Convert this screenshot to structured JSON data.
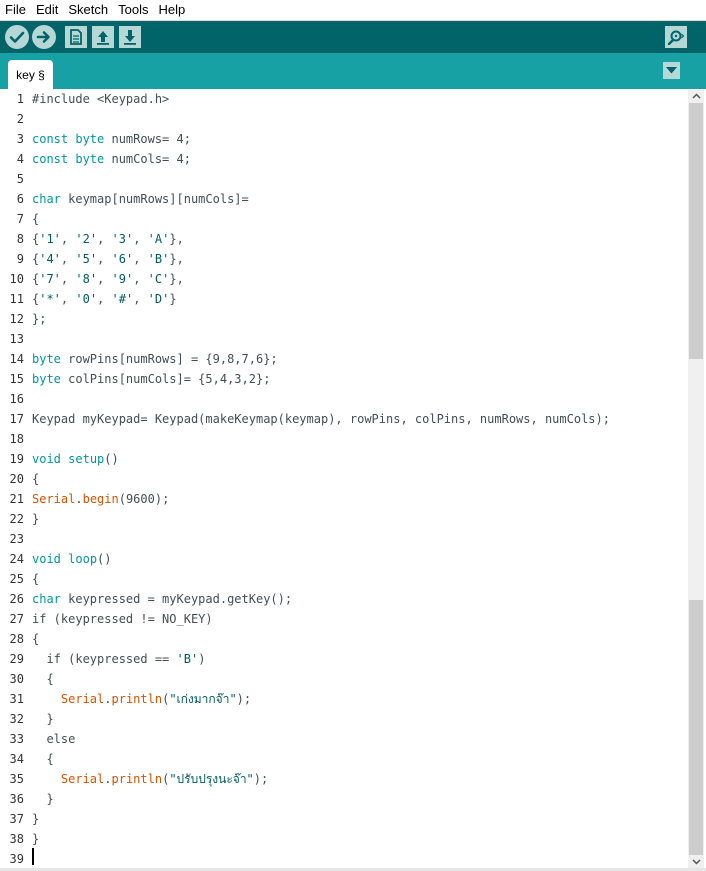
{
  "menubar": {
    "items": [
      "File",
      "Edit",
      "Sketch",
      "Tools",
      "Help"
    ]
  },
  "toolbar": {
    "buttons": [
      "check-icon",
      "arrow-right-icon",
      "new-file-icon",
      "upload-arrow-icon",
      "download-arrow-icon"
    ],
    "serial_monitor_icon": "magnifier-icon"
  },
  "tabs": [
    {
      "label": "key §",
      "active": true
    }
  ],
  "colors": {
    "toolbar_bg": "#006468",
    "tabbar_bg": "#17a1a5",
    "button_bg": "#b5d7d6",
    "keyword": "#00979c",
    "function": "#d35400",
    "string": "#005c5f",
    "text": "#434f54"
  },
  "editor": {
    "line_numbers": [
      "1",
      "2",
      "3",
      "4",
      "5",
      "6",
      "7",
      "8",
      "9",
      "10",
      "11",
      "12",
      "13",
      "14",
      "15",
      "16",
      "17",
      "18",
      "19",
      "20",
      "21",
      "22",
      "23",
      "24",
      "25",
      "26",
      "27",
      "28",
      "29",
      "30",
      "31",
      "32",
      "33",
      "34",
      "35",
      "36",
      "37",
      "38",
      "39"
    ],
    "lines": [
      [
        {
          "t": "#include <Keypad.h>",
          "c": "plain"
        }
      ],
      [],
      [
        {
          "t": "const byte",
          "c": "kw"
        },
        {
          "t": " numRows= 4;",
          "c": "plain"
        }
      ],
      [
        {
          "t": "const byte",
          "c": "kw"
        },
        {
          "t": " numCols= 4;",
          "c": "plain"
        }
      ],
      [],
      [
        {
          "t": "char",
          "c": "kw"
        },
        {
          "t": " keymap[numRows][numCols]=",
          "c": "plain"
        }
      ],
      [
        {
          "t": "{",
          "c": "plain"
        }
      ],
      [
        {
          "t": "{",
          "c": "plain"
        },
        {
          "t": "'1'",
          "c": "str"
        },
        {
          "t": ", ",
          "c": "plain"
        },
        {
          "t": "'2'",
          "c": "str"
        },
        {
          "t": ", ",
          "c": "plain"
        },
        {
          "t": "'3'",
          "c": "str"
        },
        {
          "t": ", ",
          "c": "plain"
        },
        {
          "t": "'A'",
          "c": "str"
        },
        {
          "t": "},",
          "c": "plain"
        }
      ],
      [
        {
          "t": "{",
          "c": "plain"
        },
        {
          "t": "'4'",
          "c": "str"
        },
        {
          "t": ", ",
          "c": "plain"
        },
        {
          "t": "'5'",
          "c": "str"
        },
        {
          "t": ", ",
          "c": "plain"
        },
        {
          "t": "'6'",
          "c": "str"
        },
        {
          "t": ", ",
          "c": "plain"
        },
        {
          "t": "'B'",
          "c": "str"
        },
        {
          "t": "},",
          "c": "plain"
        }
      ],
      [
        {
          "t": "{",
          "c": "plain"
        },
        {
          "t": "'7'",
          "c": "str"
        },
        {
          "t": ", ",
          "c": "plain"
        },
        {
          "t": "'8'",
          "c": "str"
        },
        {
          "t": ", ",
          "c": "plain"
        },
        {
          "t": "'9'",
          "c": "str"
        },
        {
          "t": ", ",
          "c": "plain"
        },
        {
          "t": "'C'",
          "c": "str"
        },
        {
          "t": "},",
          "c": "plain"
        }
      ],
      [
        {
          "t": "{",
          "c": "plain"
        },
        {
          "t": "'*'",
          "c": "str"
        },
        {
          "t": ", ",
          "c": "plain"
        },
        {
          "t": "'0'",
          "c": "str"
        },
        {
          "t": ", ",
          "c": "plain"
        },
        {
          "t": "'#'",
          "c": "str"
        },
        {
          "t": ", ",
          "c": "plain"
        },
        {
          "t": "'D'",
          "c": "str"
        },
        {
          "t": "}",
          "c": "plain"
        }
      ],
      [
        {
          "t": "};",
          "c": "plain"
        }
      ],
      [],
      [
        {
          "t": "byte",
          "c": "kw"
        },
        {
          "t": " rowPins[numRows] = {9,8,7,6};",
          "c": "plain"
        }
      ],
      [
        {
          "t": "byte",
          "c": "kw"
        },
        {
          "t": " colPins[numCols]= {5,4,3,2};",
          "c": "plain"
        }
      ],
      [],
      [
        {
          "t": "Keypad myKeypad= Keypad(makeKeymap(keymap), rowPins, colPins, numRows, numCols);",
          "c": "plain"
        }
      ],
      [],
      [
        {
          "t": "void",
          "c": "kw"
        },
        {
          "t": " ",
          "c": "plain"
        },
        {
          "t": "setup",
          "c": "kw"
        },
        {
          "t": "()",
          "c": "plain"
        }
      ],
      [
        {
          "t": "{",
          "c": "plain"
        }
      ],
      [
        {
          "t": "Serial",
          "c": "fn"
        },
        {
          "t": ".",
          "c": "plain"
        },
        {
          "t": "begin",
          "c": "fn"
        },
        {
          "t": "(9600);",
          "c": "plain"
        }
      ],
      [
        {
          "t": "}",
          "c": "plain"
        }
      ],
      [],
      [
        {
          "t": "void",
          "c": "kw"
        },
        {
          "t": " ",
          "c": "plain"
        },
        {
          "t": "loop",
          "c": "kw"
        },
        {
          "t": "()",
          "c": "plain"
        }
      ],
      [
        {
          "t": "{",
          "c": "plain"
        }
      ],
      [
        {
          "t": "char",
          "c": "kw"
        },
        {
          "t": " keypressed = myKeypad.getKey();",
          "c": "plain"
        }
      ],
      [
        {
          "t": "if (keypressed != NO_KEY)",
          "c": "plain"
        }
      ],
      [
        {
          "t": "{",
          "c": "plain"
        }
      ],
      [
        {
          "t": "  if (keypressed == ",
          "c": "plain"
        },
        {
          "t": "'B'",
          "c": "str"
        },
        {
          "t": ")",
          "c": "plain"
        }
      ],
      [
        {
          "t": "  {",
          "c": "plain"
        }
      ],
      [
        {
          "t": "    ",
          "c": "plain"
        },
        {
          "t": "Serial",
          "c": "fn"
        },
        {
          "t": ".",
          "c": "plain"
        },
        {
          "t": "println",
          "c": "fn"
        },
        {
          "t": "(",
          "c": "plain"
        },
        {
          "t": "\"เก่งมากจ๊า\"",
          "c": "str"
        },
        {
          "t": ");",
          "c": "plain"
        }
      ],
      [
        {
          "t": "  }",
          "c": "plain"
        }
      ],
      [
        {
          "t": "  else",
          "c": "plain"
        }
      ],
      [
        {
          "t": "  {",
          "c": "plain"
        }
      ],
      [
        {
          "t": "    ",
          "c": "plain"
        },
        {
          "t": "Serial",
          "c": "fn"
        },
        {
          "t": ".",
          "c": "plain"
        },
        {
          "t": "println",
          "c": "fn"
        },
        {
          "t": "(",
          "c": "plain"
        },
        {
          "t": "\"ปรับปรุงนะจ๊า\"",
          "c": "str"
        },
        {
          "t": ");",
          "c": "plain"
        }
      ],
      [
        {
          "t": "  }",
          "c": "plain"
        }
      ],
      [
        {
          "t": "}",
          "c": "plain"
        }
      ],
      [
        {
          "t": "}",
          "c": "plain"
        }
      ],
      []
    ]
  },
  "scrollbar": {
    "up_icon": "scroll-up-arrow-icon",
    "down_icon": "scroll-down-arrow-icon"
  }
}
